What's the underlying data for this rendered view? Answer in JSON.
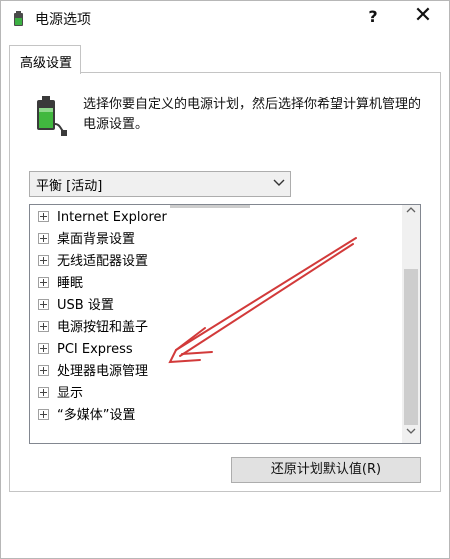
{
  "window": {
    "title": "电源选项",
    "help_glyph": "?",
    "close_glyph": "✕"
  },
  "tabs": [
    {
      "label": "高级设置"
    }
  ],
  "description": "选择你要自定义的电源计划，然后选择你希望计算机管理的电源设置。",
  "plan_select": {
    "value": "平衡 [活动]"
  },
  "tree_items": [
    {
      "label": "Internet Explorer"
    },
    {
      "label": "桌面背景设置"
    },
    {
      "label": "无线适配器设置"
    },
    {
      "label": "睡眠"
    },
    {
      "label": "USB 设置"
    },
    {
      "label": "电源按钮和盖子"
    },
    {
      "label": "PCI Express"
    },
    {
      "label": "处理器电源管理"
    },
    {
      "label": "显示"
    },
    {
      "label": "“多媒体”设置"
    }
  ],
  "restore_button": {
    "label": "还原计划默认值(R)"
  },
  "colors": {
    "annotation_arrow": "#d23a3a"
  },
  "icons": {
    "app": "power-options-icon",
    "battery": "battery-plug-icon"
  }
}
